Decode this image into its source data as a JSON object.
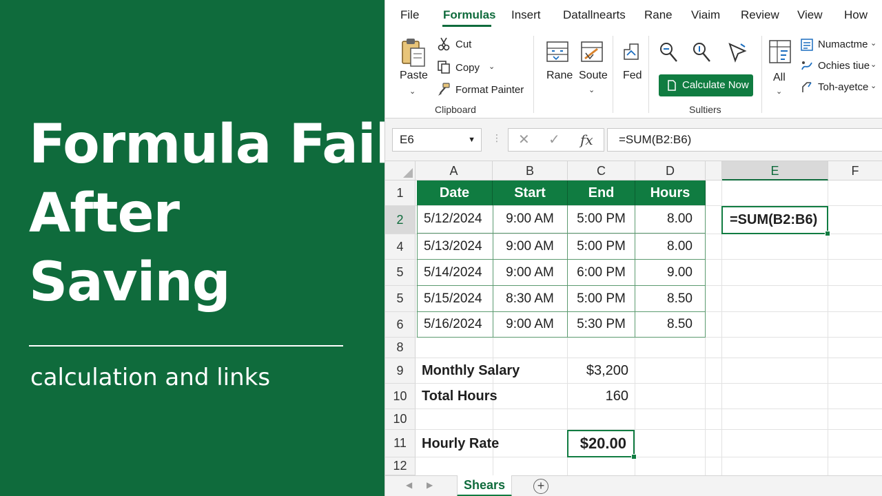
{
  "panel": {
    "headline": [
      "Formula Fails",
      "After",
      "Saving"
    ],
    "subtitle": "calculation and links"
  },
  "menu": [
    "File",
    "Formulas",
    "Insert",
    "Datallnearts",
    "Rane",
    "Viaim",
    "Review",
    "View",
    "How"
  ],
  "ribbon": {
    "paste": "Paste",
    "cut": "Cut",
    "copy": "Copy",
    "format_painter": "Format Painter",
    "clipboard_label": "Clipboard",
    "rane": "Rane",
    "soute": "Soute",
    "fed": "Fed",
    "calculate_now": "Calculate Now",
    "solutions_label": "Sultiers",
    "all": "All",
    "numactme": "Numactme",
    "ochies_tiue": "Ochies tiue",
    "toh_ayetce": "Toh-ayetce"
  },
  "formula_bar": {
    "name_box": "E6",
    "formula": "=SUM(B2:B6)"
  },
  "grid": {
    "columns": [
      "A",
      "B",
      "C",
      "D",
      "E",
      "F"
    ],
    "row_numbers": [
      "1",
      "2",
      "4",
      "5",
      "5",
      "6",
      "8",
      "9",
      "10",
      "10",
      "11",
      "12"
    ],
    "table_headers": [
      "Date",
      "Start",
      "End",
      "Hours"
    ],
    "table_rows": [
      [
        "5/12/2024",
        "9:00 AM",
        "5:00 PM",
        "8.00"
      ],
      [
        "5/13/2024",
        "9:00 AM",
        "5:00 PM",
        "8.00"
      ],
      [
        "5/14/2024",
        "9:00 AM",
        "6:00 PM",
        "9.00"
      ],
      [
        "5/15/2024",
        "8:30 AM",
        "5:00 PM",
        "8.50"
      ],
      [
        "5/16/2024",
        "9:00 AM",
        "5:30 PM",
        "8.50"
      ]
    ],
    "active_cell_text": "=SUM(B2:B6)",
    "monthly_salary_label": "Monthly Salary",
    "monthly_salary_value": "$3,200",
    "total_hours_label": "Total Hours",
    "total_hours_value": "160",
    "hourly_rate_label": "Hourly Rate",
    "hourly_rate_value": "$20.00"
  },
  "sheet_tab": "Shears",
  "colors": {
    "brand_green": "#107c41",
    "panel_green": "#0f6b3c"
  }
}
